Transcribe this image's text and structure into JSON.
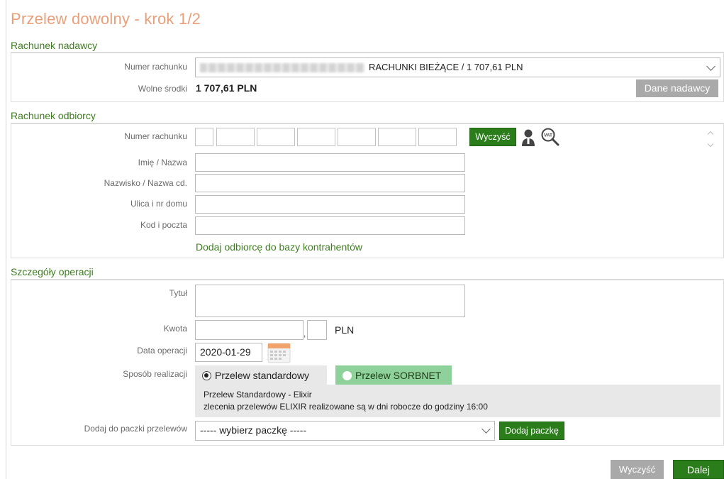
{
  "title": "Przelew dowolny - krok 1/2",
  "sender": {
    "section_title": "Rachunek nadawcy",
    "account_label": "Numer rachunku",
    "account_value_suffix": "RACHUNKI BIEŻĄCE / 1 707,61 PLN",
    "funds_label": "Wolne środki",
    "funds_value": "1 707,61 PLN",
    "details_button": "Dane nadawcy"
  },
  "recipient": {
    "section_title": "Rachunek odbiorcy",
    "account_label": "Numer rachunku",
    "clear_button": "Wyczyść",
    "vat_icon_text": "VAT",
    "name_label": "Imię / Nazwa",
    "surname_label": "Nazwisko / Nazwa cd.",
    "street_label": "Ulica i nr domu",
    "postcode_label": "Kod i poczta",
    "add_contact_link": "Dodaj odbiorcę do bazy kontrahentów"
  },
  "operation": {
    "section_title": "Szczegóły operacji",
    "title_label": "Tytuł",
    "amount_label": "Kwota",
    "amount_comma": ",",
    "currency": "PLN",
    "date_label": "Data operacji",
    "date_value": "2020-01-29",
    "method_label": "Sposób realizacji",
    "method_standard": "Przelew standardowy",
    "method_sorbnet": "Przelew SORBNET",
    "info_line1": "Przelew Standardowy - Elixir",
    "info_line2": "zlecenia przelewów ELIXIR realizowane są w dni robocze do godziny 16:00",
    "package_label": "Dodaj do paczki przelewów",
    "package_placeholder": "----- wybierz paczkę -----",
    "add_package_button": "Dodaj paczkę"
  },
  "footer": {
    "clear_button": "Wyczyść",
    "next_button": "Dalej"
  },
  "colors": {
    "accent_green": "#2a7d1a",
    "section_green": "#3d7d1f",
    "title_orange": "#e8a07a",
    "sorbnet_bg": "#8fd19a"
  }
}
